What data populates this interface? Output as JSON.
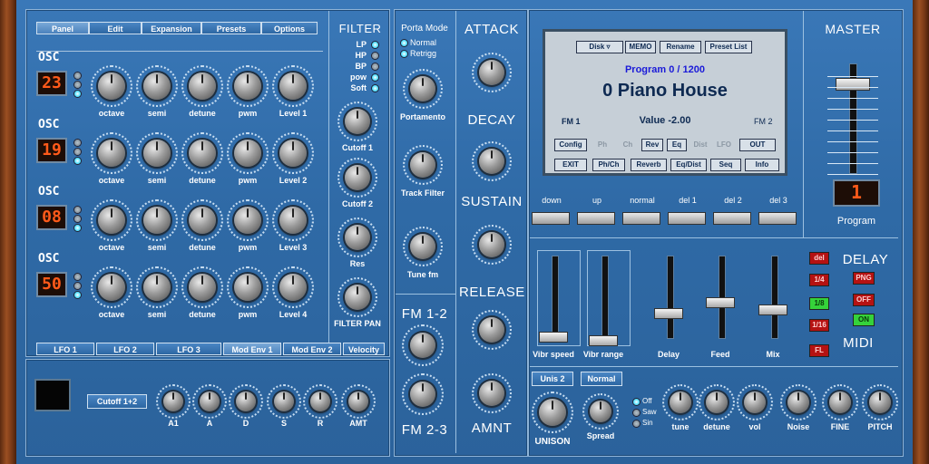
{
  "tabs": [
    "Panel",
    "Edit",
    "Expansion",
    "Presets",
    "Options"
  ],
  "osc": {
    "label": "OSC",
    "rows": [
      {
        "display": "23",
        "labels": [
          "octave",
          "semi",
          "detune",
          "pwm",
          "Level 1"
        ]
      },
      {
        "display": "19",
        "labels": [
          "octave",
          "semi",
          "detune",
          "pwm",
          "Level 2"
        ]
      },
      {
        "display": "08",
        "labels": [
          "octave",
          "semi",
          "detune",
          "pwm",
          "Level 3"
        ]
      },
      {
        "display": "50",
        "labels": [
          "octave",
          "semi",
          "detune",
          "pwm",
          "Level 4"
        ]
      }
    ]
  },
  "filter": {
    "title": "FILTER",
    "types": [
      "LP",
      "HP",
      "BP",
      "pow",
      "Soft"
    ],
    "knobs": [
      "Cutoff 1",
      "Cutoff 2",
      "Res",
      "FILTER PAN"
    ]
  },
  "porta": {
    "title": "Porta Mode",
    "options": [
      "Normal",
      "Retrigg"
    ],
    "knobs": [
      "Portamento",
      "Track Filter",
      "Tune fm"
    ]
  },
  "fm": {
    "top": "FM 1-2",
    "bottom": "FM 2-3"
  },
  "env": [
    "ATTACK",
    "DECAY",
    "SUSTAIN",
    "RELEASE",
    "AMNT"
  ],
  "lcd": {
    "buttons_top": [
      "Disk",
      "MEMO",
      "Rename",
      "Preset List"
    ],
    "program_line": "Program 0 / 1200",
    "preset_name": "0 Piano House",
    "fm1": "FM 1",
    "value": "Value  -2.00",
    "fm2": "FM 2",
    "row1": [
      "Config",
      "Ph",
      "Ch",
      "Rev",
      "Eq",
      "Dist",
      "LFO",
      "OUT"
    ],
    "row2": [
      "EXIT",
      "Ph/Ch",
      "Reverb",
      "Eq/Dist",
      "Seq",
      "Info"
    ]
  },
  "nav_buttons": [
    "down",
    "up",
    "normal",
    "del 1",
    "del 2",
    "del 3"
  ],
  "master": {
    "title": "MASTER",
    "program_label": "Program",
    "program_display": "1"
  },
  "faders": [
    "Vibr speed",
    "Vibr range",
    "Delay",
    "Feed",
    "Mix"
  ],
  "delay": {
    "title": "DELAY",
    "buttons": [
      "del",
      "1/4",
      "1/8",
      "1/16",
      "FL"
    ],
    "right": [
      "PNG",
      "OFF",
      "ON"
    ]
  },
  "midi": "MIDI",
  "lfo_tabs": [
    "LFO 1",
    "LFO 2",
    "LFO 3",
    "Mod Env 1",
    "Mod Env 2",
    "Velocity"
  ],
  "mod_env": {
    "target": "Cutoff 1+2",
    "knobs": [
      "A1",
      "A",
      "D",
      "S",
      "R",
      "AMT"
    ]
  },
  "unison": {
    "buttons": [
      "Unis 2",
      "Normal"
    ],
    "knobs": [
      "UNISON",
      "Spread"
    ],
    "waves": [
      "Off",
      "Saw",
      "Sin"
    ],
    "extra_knobs": [
      "tune",
      "detune",
      "vol",
      "Noise",
      "FINE",
      "PITCH"
    ]
  }
}
